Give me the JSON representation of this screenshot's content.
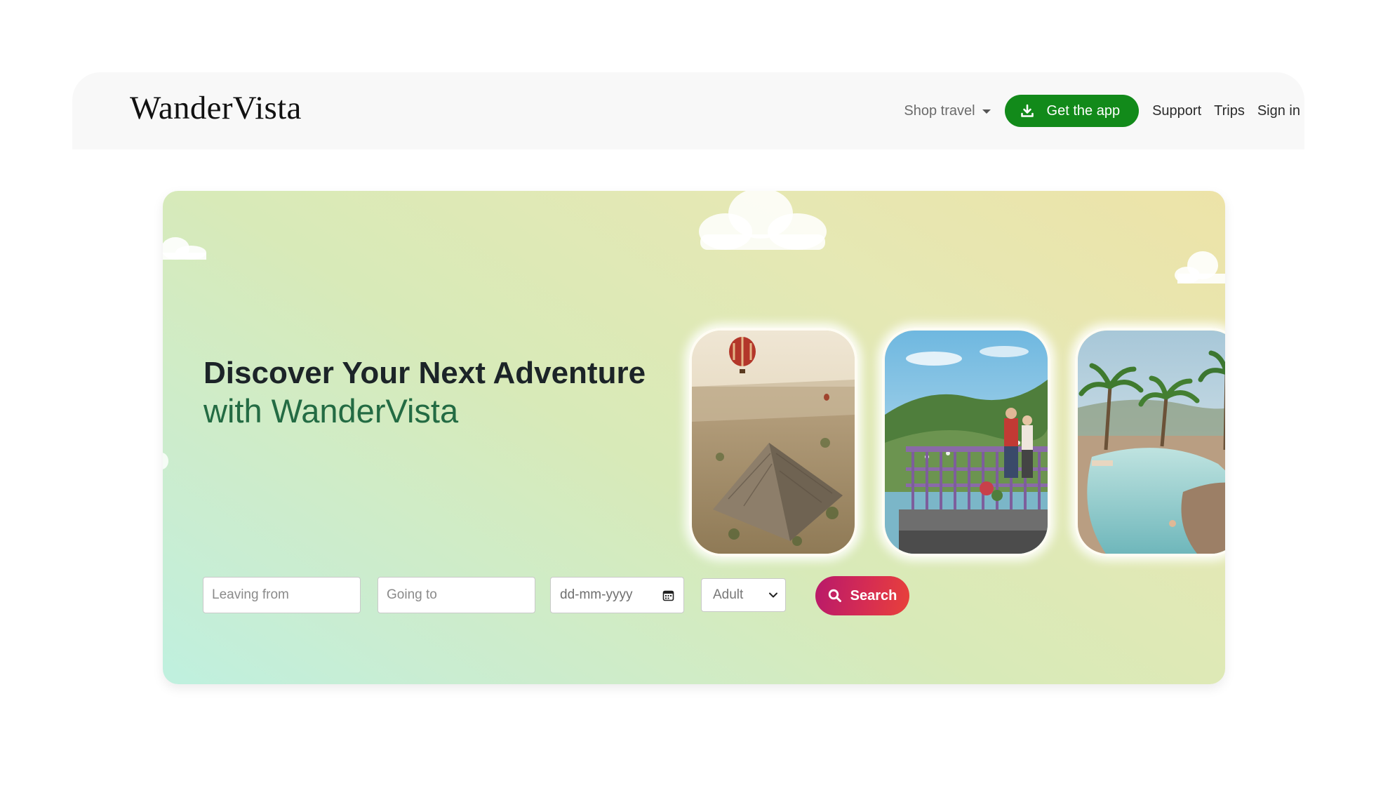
{
  "nav": {
    "brand": "WanderVista",
    "shop_travel": "Shop travel",
    "get_app": "Get the app",
    "support": "Support",
    "trips": "Trips",
    "sign_in": "Sign in"
  },
  "hero": {
    "title_line1": "Discover Your Next Adventure",
    "title_line2": "with WanderVista"
  },
  "search": {
    "leaving_placeholder": "Leaving from",
    "going_placeholder": "Going to",
    "date_placeholder": "dd-mm-yyyy",
    "traveler_selected": "Adult",
    "button_label": "Search"
  },
  "colors": {
    "primary_green": "#128a1a",
    "title_green": "#236b43",
    "search_gradient_start": "#b8196a",
    "search_gradient_end": "#e8413a"
  },
  "icons": {
    "download": "download-icon",
    "dropdown": "caret-down-icon",
    "calendar": "calendar-icon",
    "select": "chevron-down-icon",
    "search": "search-icon"
  }
}
